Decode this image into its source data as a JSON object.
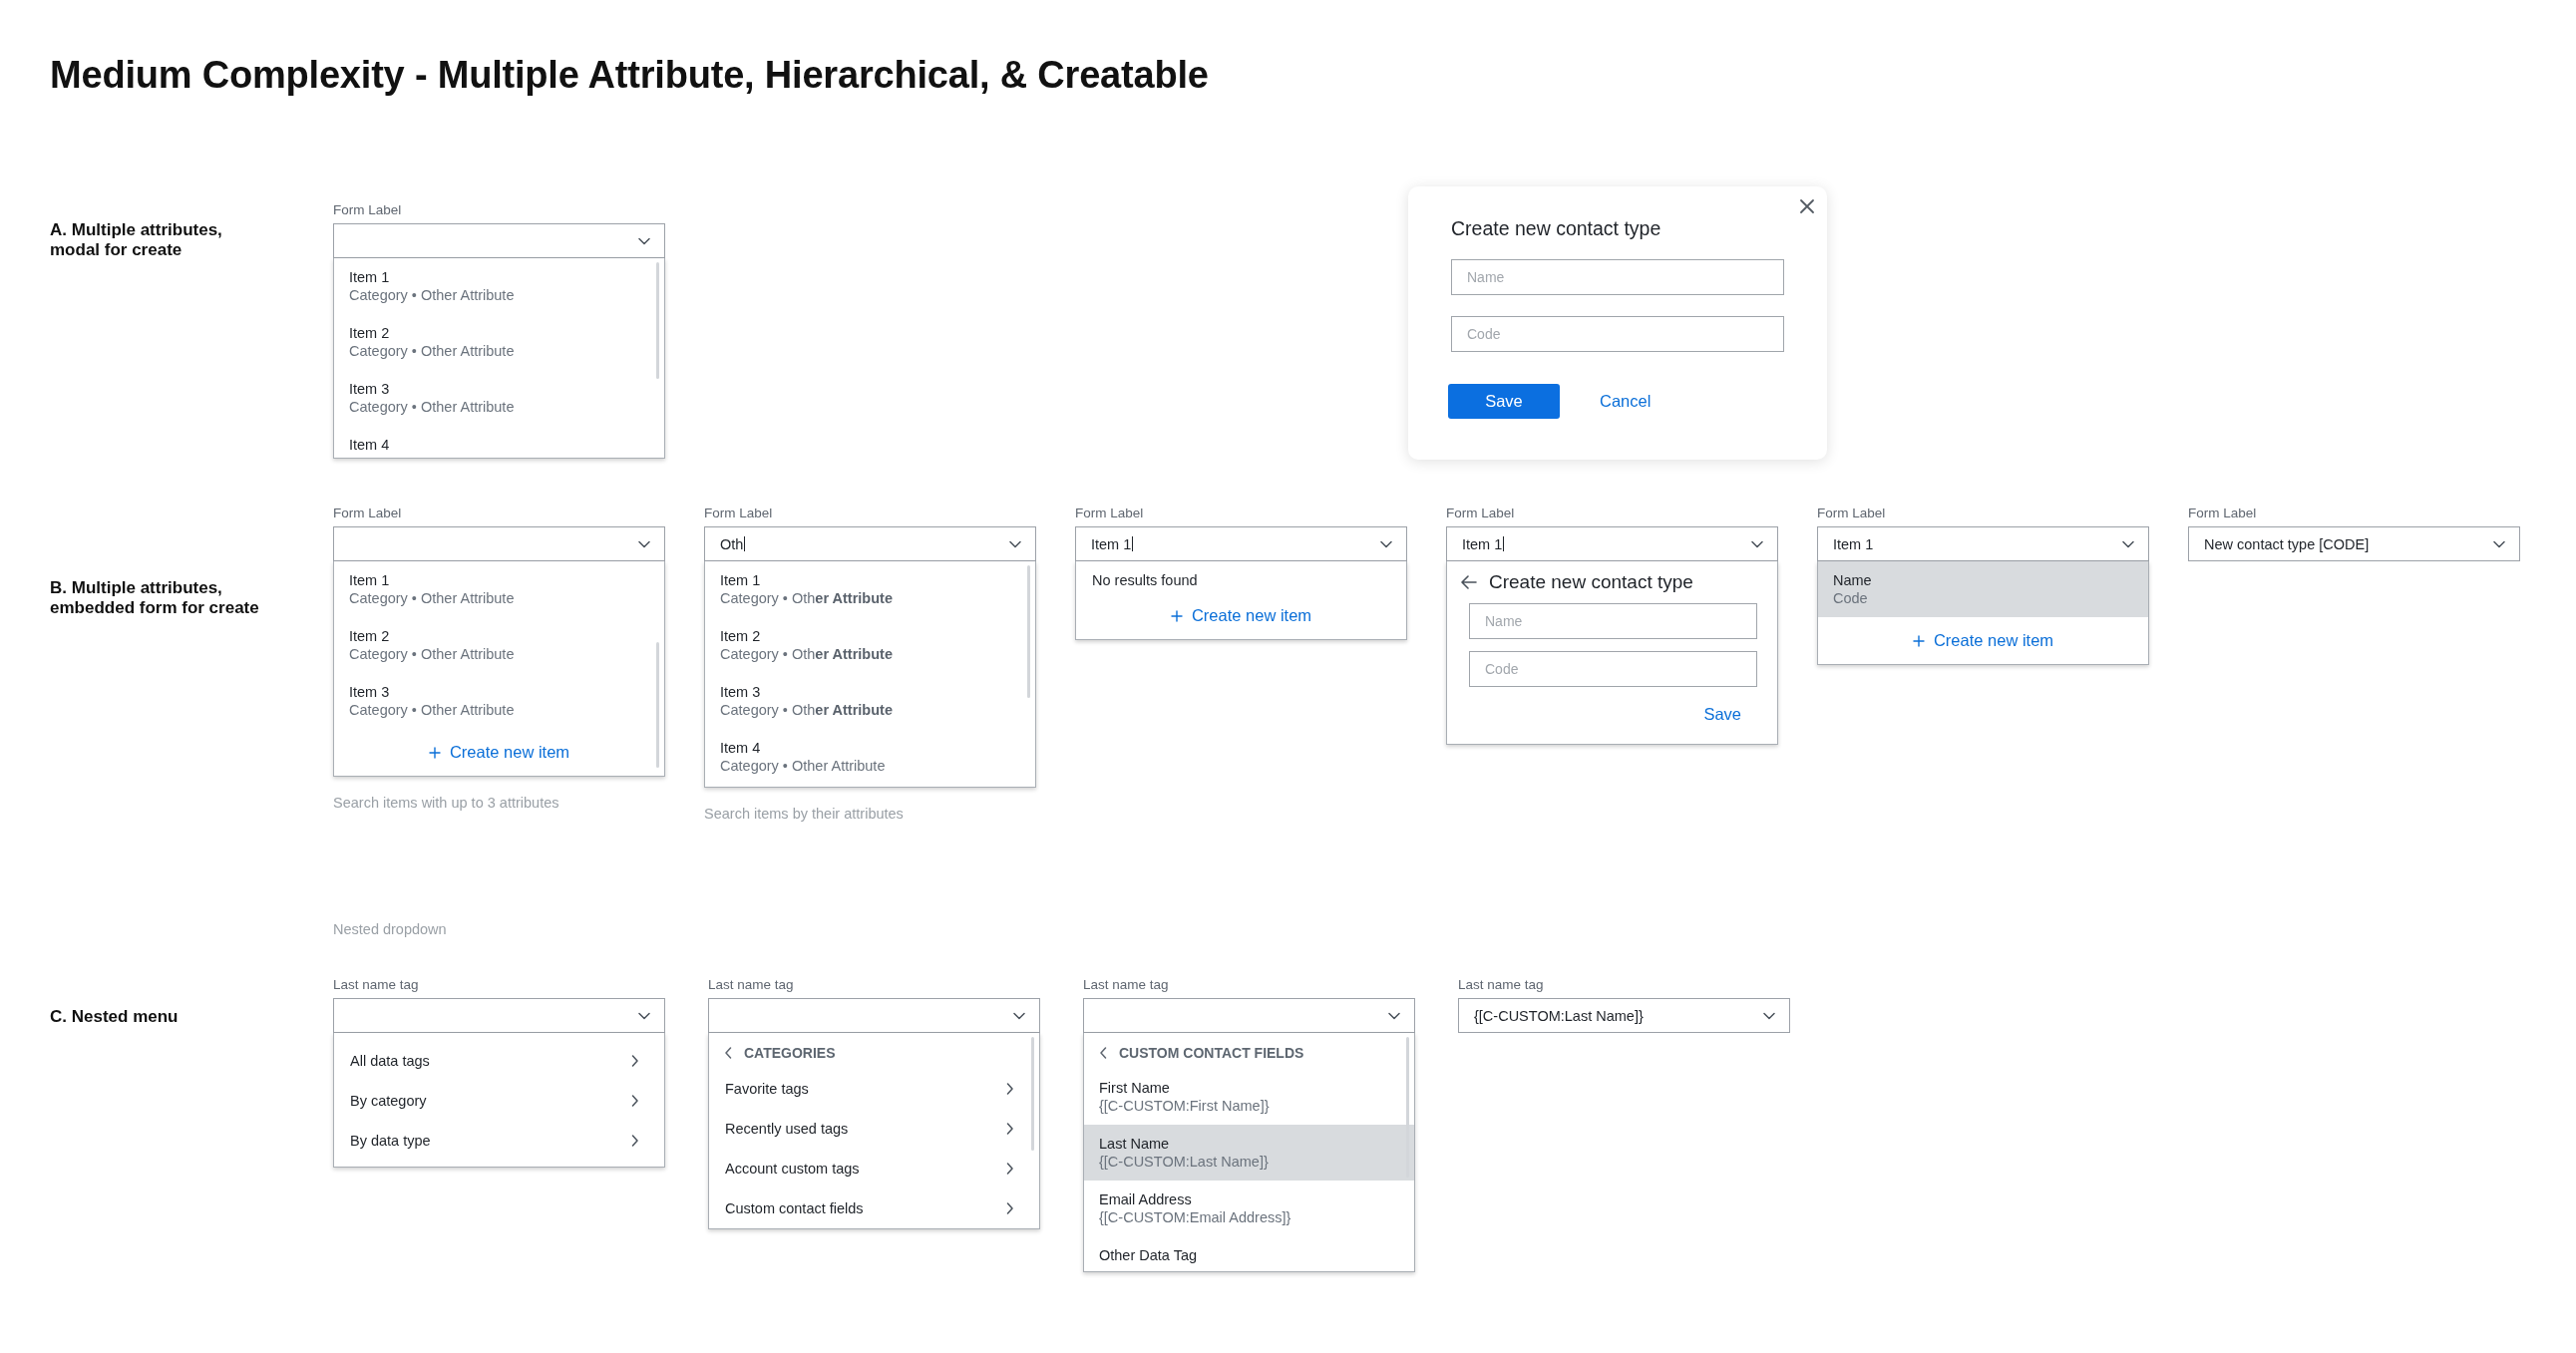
{
  "title": "Medium Complexity - Multiple Attribute, Hierarchical, & Creatable",
  "sections": [
    {
      "label": "A. Multiple attributes,\nmodal for create",
      "widgets": [
        {
          "kind": "select",
          "label": "Form Label",
          "focused": false,
          "menu": {
            "scrollbar": true,
            "scrolled": false,
            "items": [
              {
                "kind": "option",
                "title": "Item 1",
                "subtitle": "Category • Other Attribute",
                "selected": false
              },
              {
                "kind": "option",
                "title": "Item 2",
                "subtitle": "Category • Other Attribute",
                "selected": false
              },
              {
                "kind": "option",
                "title": "Item 3",
                "subtitle": "Category • Other Attribute",
                "selected": false
              },
              {
                "kind": "option",
                "title": "Item 4",
                "selected": false
              }
            ]
          }
        },
        {
          "kind": "modal",
          "title": "Create new contact type",
          "fields": [
            {
              "placeholder": "Name"
            },
            {
              "placeholder": "Code"
            }
          ],
          "primary": "Save",
          "secondary": "Cancel"
        }
      ]
    },
    {
      "label": "B. Multiple attributes,\nembedded form for create",
      "widgets": [
        {
          "kind": "select",
          "label": "Form Label",
          "focused": false,
          "helper": "Search items with up to 3 attributes",
          "menu": {
            "scrollbar": true,
            "scrolled": true,
            "items": [
              {
                "kind": "option",
                "title": "Item 1",
                "subtitle": "Category • Other Attribute",
                "selected": false
              },
              {
                "kind": "option",
                "title": "Item 2",
                "subtitle": "Category • Other Attribute",
                "selected": false
              },
              {
                "kind": "option",
                "title": "Item 3",
                "subtitle": "Category • Other Attribute",
                "selected": false
              },
              {
                "kind": "create",
                "label": "Create new item"
              }
            ]
          }
        },
        {
          "kind": "select",
          "label": "Form Label",
          "value": "Oth",
          "focused": true,
          "helper": "Search items by their attributes",
          "menu": {
            "scrollbar": true,
            "scrolled": false,
            "items": [
              {
                "kind": "option",
                "title": "Item 1",
                "subtitle": "Category • Oth**er Attribute**",
                "selected": false
              },
              {
                "kind": "option",
                "title": "Item 2",
                "subtitle": "Category • Oth**er Attribute**",
                "selected": false
              },
              {
                "kind": "option",
                "title": "Item 3",
                "subtitle": "Category • Oth**er Attribute**",
                "selected": false
              },
              {
                "kind": "option",
                "title": "Item 4",
                "subtitle": "Category • Other Attribute",
                "selected": false
              }
            ]
          }
        },
        {
          "kind": "select",
          "label": "Form Label",
          "value": "Item 1",
          "focused": true,
          "menu": {
            "scrollbar": false,
            "items": [
              {
                "kind": "empty",
                "label": "No results found"
              },
              {
                "kind": "create",
                "label": "Create new item"
              }
            ]
          }
        },
        {
          "kind": "select",
          "label": "Form Label",
          "value": "Item 1",
          "focused": true,
          "menu": {
            "scrollbar": false,
            "items": [
              {
                "kind": "form",
                "title": "Create new contact type",
                "fields": [
                  {
                    "placeholder": "Name"
                  },
                  {
                    "placeholder": "Code"
                  }
                ],
                "action": "Save"
              }
            ]
          }
        },
        {
          "kind": "select",
          "label": "Form Label",
          "value": "Item 1",
          "focused": false,
          "menu": {
            "scrollbar": false,
            "items": [
              {
                "kind": "option",
                "title": "Name",
                "subtitle": "Code",
                "selected": true
              },
              {
                "kind": "create",
                "label": "Create new item"
              }
            ]
          }
        },
        {
          "kind": "select",
          "label": "Form Label",
          "value": "New contact type [CODE]",
          "focused": false
        }
      ]
    },
    {
      "note": "Nested dropdown",
      "label": "C. Nested menu",
      "widgets": [
        {
          "kind": "select",
          "label": "Last name tag",
          "focused": false,
          "menu": {
            "scrollbar": false,
            "items": [
              {
                "kind": "nav",
                "label": "All data tags"
              },
              {
                "kind": "nav",
                "label": "By category"
              },
              {
                "kind": "nav",
                "label": "By data type"
              }
            ]
          }
        },
        {
          "kind": "select",
          "label": "Last name tag",
          "focused": false,
          "menu": {
            "scrollbar": true,
            "scrolled": false,
            "items": [
              {
                "kind": "header",
                "label": "CATEGORIES"
              },
              {
                "kind": "nav",
                "label": "Favorite tags"
              },
              {
                "kind": "nav",
                "label": "Recently used tags"
              },
              {
                "kind": "nav",
                "label": "Account custom tags"
              },
              {
                "kind": "nav",
                "label": "Custom contact fields"
              }
            ]
          }
        },
        {
          "kind": "select",
          "label": "Last name tag",
          "focused": false,
          "menu": {
            "scrollbar": true,
            "scrolled": false,
            "items": [
              {
                "kind": "header",
                "label": "CUSTOM CONTACT FIELDS"
              },
              {
                "kind": "option",
                "title": "First Name",
                "subtitle": "{[C-CUSTOM:First Name]}",
                "selected": false
              },
              {
                "kind": "option",
                "title": "Last Name",
                "subtitle": "{[C-CUSTOM:Last Name]}",
                "selected": true
              },
              {
                "kind": "option",
                "title": "Email Address",
                "subtitle": "{[C-CUSTOM:Email Address]}",
                "selected": false
              },
              {
                "kind": "option",
                "title": "Other Data Tag",
                "selected": false
              }
            ]
          }
        },
        {
          "kind": "select",
          "label": "Last name tag",
          "value": "{[C-CUSTOM:Last Name]}",
          "focused": false
        }
      ]
    }
  ]
}
